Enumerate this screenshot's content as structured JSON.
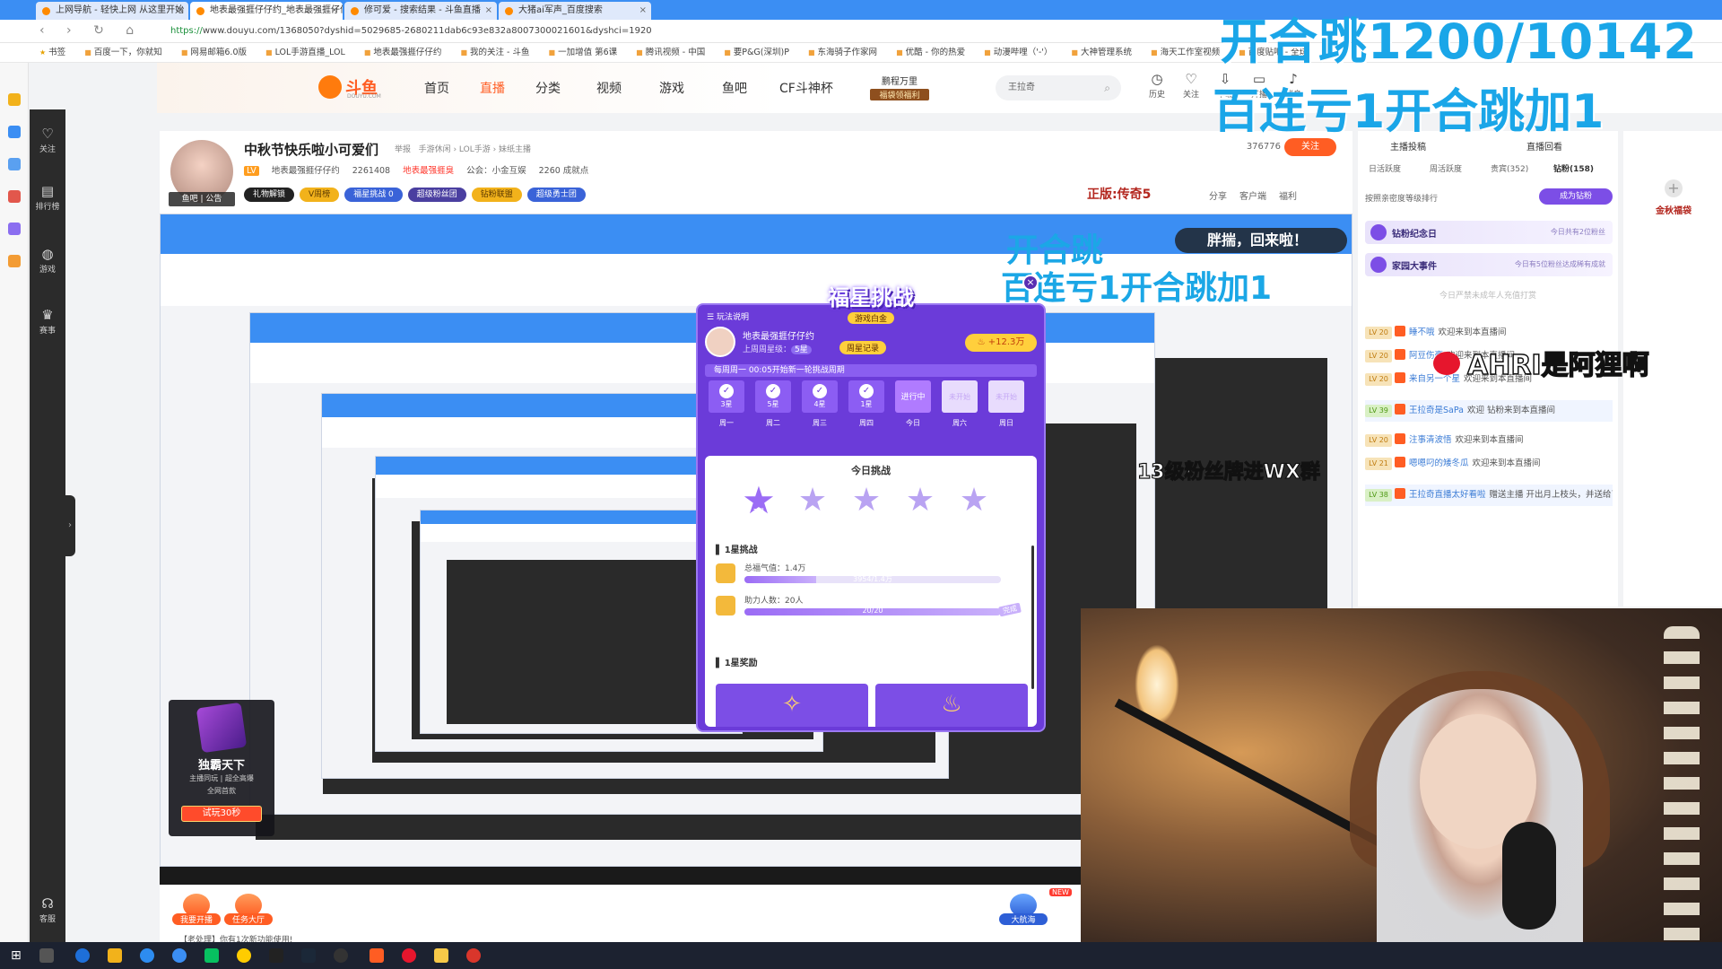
{
  "browser": {
    "tabs": [
      {
        "label": "上网导航 - 轻快上网 从这里开始"
      },
      {
        "label": "地表最强捱仔仔约_地表最强捱仔仔约直播间"
      },
      {
        "label": "修可爱 - 搜索结果 - 斗鱼直播"
      },
      {
        "label": "大猪ai军声_百度搜索"
      }
    ],
    "url_scheme": "https://",
    "url_rest": "www.douyu.com/1368050?dyshid=5029685-2680211dab6c93e832a8007300021601&dyshci=1920",
    "bookmarks": [
      "书签",
      "百度一下，你就知",
      "网易邮箱6.0版",
      "LOL手游直播_LOL",
      "地表最强捱仔仔约",
      "我的关注 - 斗鱼",
      "一加增值 第6课",
      "腾讯视频 - 中国",
      "要P&G(深圳)P",
      "东海骑子作家网",
      "优酷 - 你的热爱",
      "动漫哔哩（'-'）",
      "大神管理系统",
      "海天工作室视频",
      "百度贴吧 - 全球"
    ]
  },
  "douyu": {
    "logo_text": "斗鱼",
    "logo_sub": "DOUYU.COM",
    "nav": [
      "首页",
      "直播",
      "分类",
      "视频",
      "游戏",
      "鱼吧",
      "CF斗神杯"
    ],
    "promo_top": "鹏程万里",
    "promo_tag": "福袋领福利",
    "search_placeholder": "王拉奇",
    "header_icons": [
      {
        "label": "历史"
      },
      {
        "label": "关注"
      },
      {
        "label": "下载"
      },
      {
        "label": "开播"
      },
      {
        "label": "消息"
      }
    ],
    "sidebar": [
      {
        "label": "关注"
      },
      {
        "label": "排行榜"
      },
      {
        "label": "游戏"
      },
      {
        "label": "赛事"
      },
      {
        "label": "客服"
      }
    ]
  },
  "room": {
    "title": "中秋节快乐啦小可爱们",
    "report": "举报",
    "breadcrumb": "手游休闲 › LOL手游 › 妹纸主播",
    "level": "LV",
    "owner": "地表最强捱仔仔约",
    "hot": "2261408",
    "badge": "地表最强捱臭",
    "notice": "公会：小金互娱",
    "achievements": "2260 成就点",
    "avatar_tags": "鱼吧 | 公告",
    "pills": [
      {
        "label": "礼物解锁"
      },
      {
        "label": "V周榜"
      },
      {
        "label": "福星挑战 0"
      },
      {
        "label": "超级粉丝团"
      },
      {
        "label": "钻粉联盟"
      },
      {
        "label": "超级勇士团"
      }
    ],
    "fans": "376776",
    "follow": "关注",
    "game_tag": "正版:传奇5",
    "tools": [
      "分享",
      "客户端",
      "福利"
    ]
  },
  "overlay": {
    "line1": "开合跳1200/10142",
    "line2": "百连亏1开合跳加1",
    "ahri": "AHRI是阿狸啊",
    "fan_badge": "13级粉丝牌进WX群",
    "welcome": "胖揣，回来啦！",
    "nested_line1": "开合跳",
    "nested_line2": "百连亏1开合跳加1"
  },
  "game_widget": {
    "title": "独霸天下",
    "row1": "主播同玩 | 超全高爆",
    "row2": "全网首款",
    "try": "试玩30秒"
  },
  "popup": {
    "banner": "福星挑战",
    "banner_sub": "游戏白金",
    "header": "玩法说明",
    "user": "地表最强捱仔仔约",
    "week_level_label": "上周周星级：",
    "week_level": "5星",
    "record": "周星记录",
    "hot": "+12.3万",
    "strip": "每周周一 00:05开始新一轮挑战周期",
    "days": [
      {
        "v": "3星",
        "lb": "周一",
        "state": "done"
      },
      {
        "v": "5星",
        "lb": "周二",
        "state": "done"
      },
      {
        "v": "4星",
        "lb": "周三",
        "state": "done"
      },
      {
        "v": "1星",
        "lb": "周四",
        "state": "done"
      },
      {
        "v": "进行中",
        "lb": "今日",
        "state": "cur"
      },
      {
        "v": "未开始",
        "lb": "周六",
        "state": "future"
      },
      {
        "v": "未开始",
        "lb": "周日",
        "state": "future"
      }
    ],
    "today_title": "今日挑战",
    "stars": [
      "1星",
      "2星",
      "3星",
      "4星",
      "5星"
    ],
    "challenge_title": "1星挑战",
    "task1_label": "总福气值：1.4万",
    "task1_progress": "3954/1.4万",
    "task1_fraction": 0.28,
    "task2_label": "助力人数：20人",
    "task2_progress": "20/20",
    "task2_fraction": 1.0,
    "task2_done": "完成",
    "reward_title": "1星奖励",
    "reward_glyphs": [
      "✧",
      "♨"
    ]
  },
  "below": {
    "buttons": [
      {
        "label": "我要开播"
      },
      {
        "label": "任务大厅"
      }
    ],
    "right_buttons": [
      {
        "label": "大航海"
      },
      {
        "label": "NEW"
      }
    ],
    "notice": "【老处理】你有1次新功能使用!"
  },
  "right_panel": {
    "top": [
      "主播投稿",
      "直播回看"
    ],
    "tabs": [
      "日活跃度",
      "周活跃度",
      "贵宾(352)",
      "钻粉(158)"
    ],
    "sort": "按照亲密度等级排行",
    "become": "成为钻粉",
    "cards": [
      {
        "title": "钻粉纪念日",
        "sub": "今日共有2位粉丝"
      },
      {
        "title": "家园大事件",
        "sub": "今日有5位粉丝达成稀有成就"
      }
    ],
    "faded": "今日严禁未成年人充值打赏",
    "chat": [
      {
        "lv": "LV 20",
        "user": "睡不哦",
        "text": "欢迎来到本直播间"
      },
      {
        "lv": "LV 20",
        "user": "阿豆伤豪",
        "text": "欢迎来到本直播间"
      },
      {
        "lv": "LV 20",
        "user": "来自另一个星",
        "text": "欢迎来到本直播间"
      },
      {
        "lv": "LV 39",
        "user": "王拉奇是SaPa",
        "text": "欢迎 钻粉来到本直播间"
      },
      {
        "lv": "LV 20",
        "user": "注事清波悟",
        "text": "欢迎来到本直播间"
      },
      {
        "lv": "LV 21",
        "user": "嗯嗯叼的矮冬瓜",
        "text": "欢迎来到本直播间"
      },
      {
        "lv": "LV 38",
        "user": "王拉奇直播太好看啦",
        "text": "赠送主播 开出月上枝头，并送给了主播"
      }
    ],
    "fest": "金秋福袋"
  },
  "colors": {
    "accent": "#ff5d23",
    "overlay_blue": "#1aa6e8",
    "popup_purple": "#6b3bd9"
  }
}
